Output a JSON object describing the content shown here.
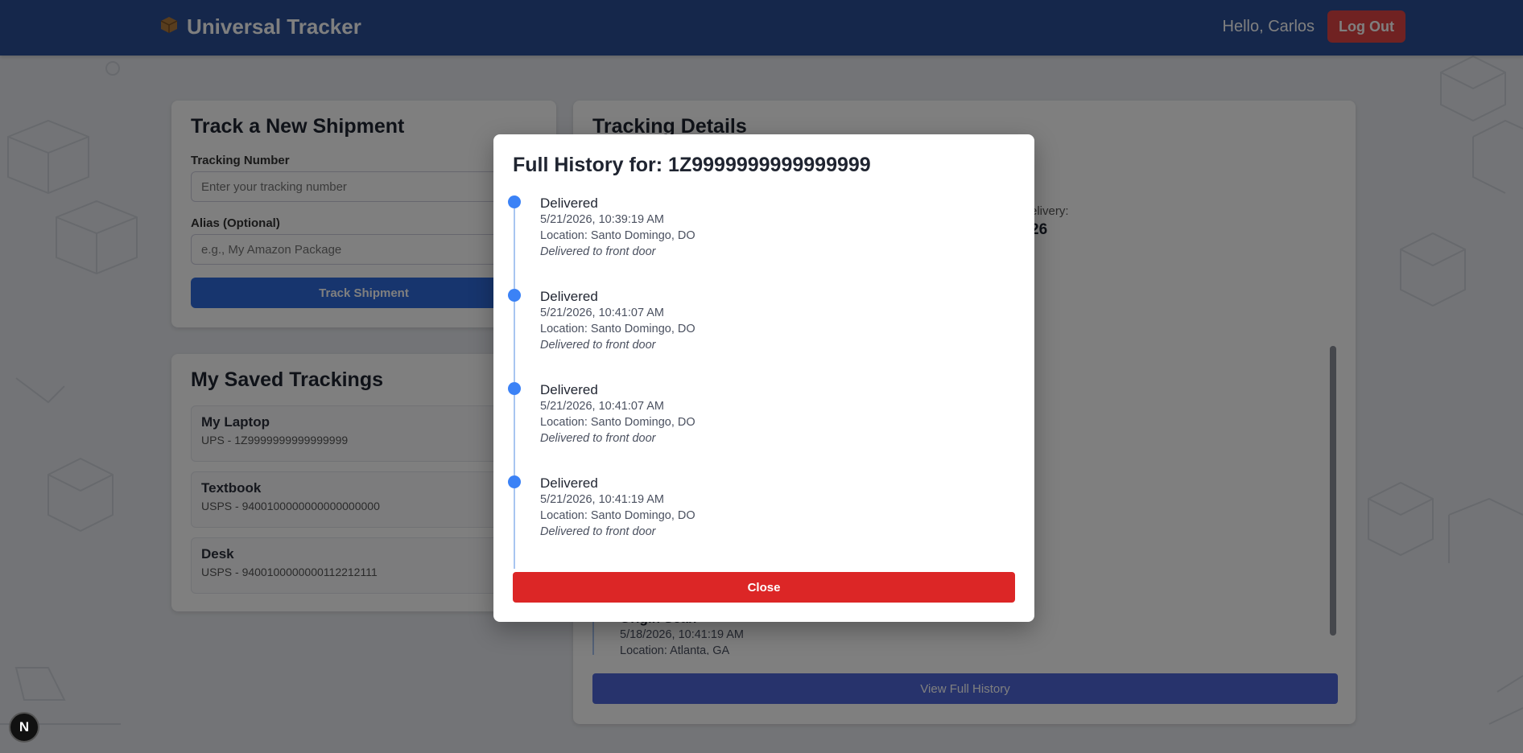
{
  "app": {
    "title": "Universal Tracker",
    "greeting": "Hello, Carlos",
    "logout_label": "Log Out"
  },
  "track_form": {
    "heading": "Track a New Shipment",
    "tracking_label": "Tracking Number",
    "tracking_placeholder": "Enter your tracking number",
    "alias_label": "Alias (Optional)",
    "alias_placeholder": "e.g., My Amazon Package",
    "submit_label": "Track Shipment"
  },
  "saved": {
    "heading": "My Saved Trackings",
    "items": [
      {
        "name": "My Laptop",
        "sub": "UPS - 1Z9999999999999999"
      },
      {
        "name": "Textbook",
        "sub": "USPS - 9400100000000000000000"
      },
      {
        "name": "Desk",
        "sub": "USPS - 9400100000000112212111"
      }
    ]
  },
  "details": {
    "heading": "Tracking Details",
    "delivery_label_fragment": "elivery:",
    "delivery_value_fragment": "26",
    "partial_entry": {
      "status": "Origin Scan",
      "time": "5/18/2026, 10:41:19 AM",
      "location": "Location: Atlanta, GA"
    },
    "view_full_label": "View Full History"
  },
  "modal": {
    "title": "Full History for: 1Z9999999999999999",
    "entries": [
      {
        "status": "Delivered",
        "time": "5/21/2026, 10:39:19 AM",
        "location": "Location: Santo Domingo, DO",
        "description": "Delivered to front door"
      },
      {
        "status": "Delivered",
        "time": "5/21/2026, 10:41:07 AM",
        "location": "Location: Santo Domingo, DO",
        "description": "Delivered to front door"
      },
      {
        "status": "Delivered",
        "time": "5/21/2026, 10:41:07 AM",
        "location": "Location: Santo Domingo, DO",
        "description": "Delivered to front door"
      },
      {
        "status": "Delivered",
        "time": "5/21/2026, 10:41:19 AM",
        "location": "Location: Santo Domingo, DO",
        "description": "Delivered to front door"
      }
    ],
    "close_label": "Close"
  },
  "badge": {
    "letter": "N"
  },
  "colors": {
    "navbar": "#2b4f96",
    "primary": "#2f6bdc",
    "danger": "#dc2626",
    "timeline_dot": "#3b82f6"
  }
}
